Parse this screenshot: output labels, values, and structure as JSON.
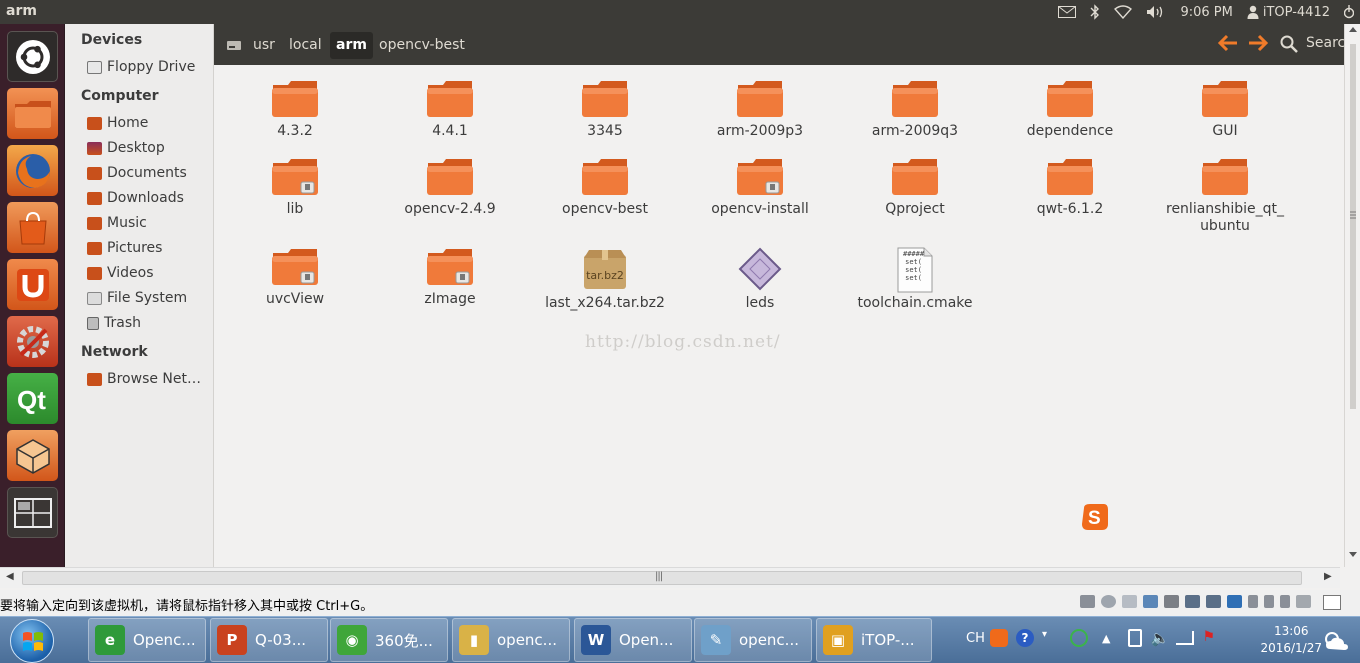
{
  "window": {
    "title": "arm"
  },
  "top_panel": {
    "time": "9:06 PM",
    "user": "iTOP-4412"
  },
  "launcher": {
    "items": [
      "ubuntu-dash",
      "home-folder",
      "firefox",
      "software-center",
      "ubuntu-one",
      "system-settings",
      "qt-creator",
      "virtualbox",
      "workspace-switcher"
    ]
  },
  "sidebar": {
    "devices_header": "Devices",
    "devices": [
      {
        "label": "Floppy Drive"
      }
    ],
    "computer_header": "Computer",
    "computer": [
      {
        "label": "Home"
      },
      {
        "label": "Desktop"
      },
      {
        "label": "Documents"
      },
      {
        "label": "Downloads"
      },
      {
        "label": "Music"
      },
      {
        "label": "Pictures"
      },
      {
        "label": "Videos"
      },
      {
        "label": "File System"
      },
      {
        "label": "Trash"
      }
    ],
    "network_header": "Network",
    "network": [
      {
        "label": "Browse Net…"
      }
    ]
  },
  "pathbar": {
    "crumbs": [
      "usr",
      "local",
      "arm",
      "opencv-best"
    ],
    "active": "arm",
    "search_label": "Search"
  },
  "files": [
    {
      "name": "4.3.2",
      "kind": "folder"
    },
    {
      "name": "4.4.1",
      "kind": "folder"
    },
    {
      "name": "3345",
      "kind": "folder"
    },
    {
      "name": "arm-2009p3",
      "kind": "folder"
    },
    {
      "name": "arm-2009q3",
      "kind": "folder"
    },
    {
      "name": "dependence",
      "kind": "folder"
    },
    {
      "name": "GUI",
      "kind": "folder"
    },
    {
      "name": "lib",
      "kind": "folder-locked"
    },
    {
      "name": "opencv-2.4.9",
      "kind": "folder"
    },
    {
      "name": "opencv-best",
      "kind": "folder"
    },
    {
      "name": "opencv-install",
      "kind": "folder-locked"
    },
    {
      "name": "Qproject",
      "kind": "folder"
    },
    {
      "name": "qwt-6.1.2",
      "kind": "folder"
    },
    {
      "name": "renlianshibie_qt_ubuntu",
      "kind": "folder",
      "line1": "renlianshibie_qt_",
      "line2": "ubuntu"
    },
    {
      "name": "uvcView",
      "kind": "folder-locked"
    },
    {
      "name": "zImage",
      "kind": "folder-locked"
    },
    {
      "name": "last_x264.tar.bz2",
      "kind": "archive",
      "badge": "tar.bz2"
    },
    {
      "name": "leds",
      "kind": "executable"
    },
    {
      "name": "toolchain.cmake",
      "kind": "text",
      "preview": "#####\nset(\nset(\nset("
    }
  ],
  "watermark": "http://blog.csdn.net/",
  "host": {
    "status_message": "要将输入定向到该虚拟机，请将鼠标指针移入其中或按 Ctrl+G。",
    "taskbar": [
      {
        "label": "Openc...",
        "color": "#2f9a3a",
        "glyph": "e"
      },
      {
        "label": "Q-03...",
        "color": "#c9421f",
        "glyph": "P"
      },
      {
        "label": "360免...",
        "color": "#3fa63a",
        "glyph": "◉"
      },
      {
        "label": "openc...",
        "color": "#d9b247",
        "glyph": "▮"
      },
      {
        "label": "Open...",
        "color": "#2b5797",
        "glyph": "W"
      },
      {
        "label": "openc...",
        "color": "#6fa0c9",
        "glyph": "✎"
      },
      {
        "label": "iTOP-...",
        "color": "#e0a020",
        "glyph": "▣"
      }
    ],
    "tray_lang": "CH",
    "clock_time": "13:06",
    "clock_date": "2016/1/27"
  }
}
